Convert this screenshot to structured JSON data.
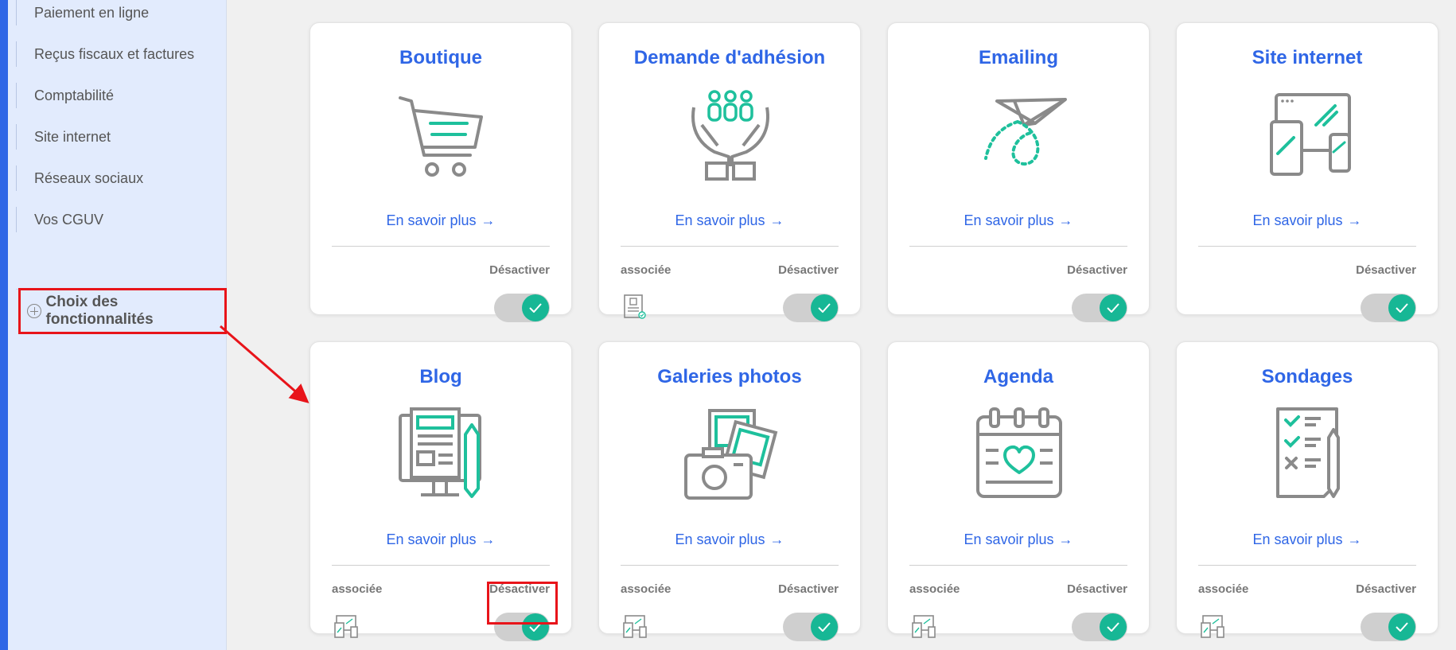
{
  "sidebar": {
    "items": [
      {
        "label": "Paiement en ligne"
      },
      {
        "label": "Reçus fiscaux et factures"
      },
      {
        "label": "Comptabilité"
      },
      {
        "label": "Site internet"
      },
      {
        "label": "Réseaux sociaux"
      },
      {
        "label": "Vos CGUV"
      }
    ],
    "feature_choice": {
      "label": "Choix des fonctionnalités",
      "icon": "plus-circle-icon",
      "highlighted": true
    }
  },
  "labels": {
    "learn_more": "En savoir plus",
    "deactivate": "Désactiver",
    "associated": "associée"
  },
  "colors": {
    "accent": "#2f66e6",
    "toggle_on": "#17b795",
    "icon_gray": "#8a8a8a",
    "icon_green": "#1ec09c",
    "annotation": "#e8141a"
  },
  "cards": [
    {
      "title": "Boutique",
      "icon": "shopping-cart-icon",
      "associated": false,
      "toggle_on": true
    },
    {
      "title": "Demande d'adhésion",
      "icon": "membership-hands-icon",
      "associated": true,
      "associated_icon": "membership-form-icon",
      "toggle_on": true
    },
    {
      "title": "Emailing",
      "icon": "paper-plane-icon",
      "associated": false,
      "toggle_on": true
    },
    {
      "title": "Site internet",
      "icon": "devices-icon",
      "associated": false,
      "toggle_on": true
    },
    {
      "title": "Blog",
      "icon": "blog-icon",
      "associated": true,
      "associated_icon": "devices-icon",
      "toggle_on": true,
      "toggle_highlighted": true
    },
    {
      "title": "Galeries photos",
      "icon": "photo-gallery-icon",
      "associated": true,
      "associated_icon": "devices-icon",
      "toggle_on": true
    },
    {
      "title": "Agenda",
      "icon": "calendar-icon",
      "associated": true,
      "associated_icon": "devices-icon",
      "toggle_on": true
    },
    {
      "title": "Sondages",
      "icon": "survey-icon",
      "associated": true,
      "associated_icon": "devices-icon",
      "toggle_on": true
    }
  ]
}
